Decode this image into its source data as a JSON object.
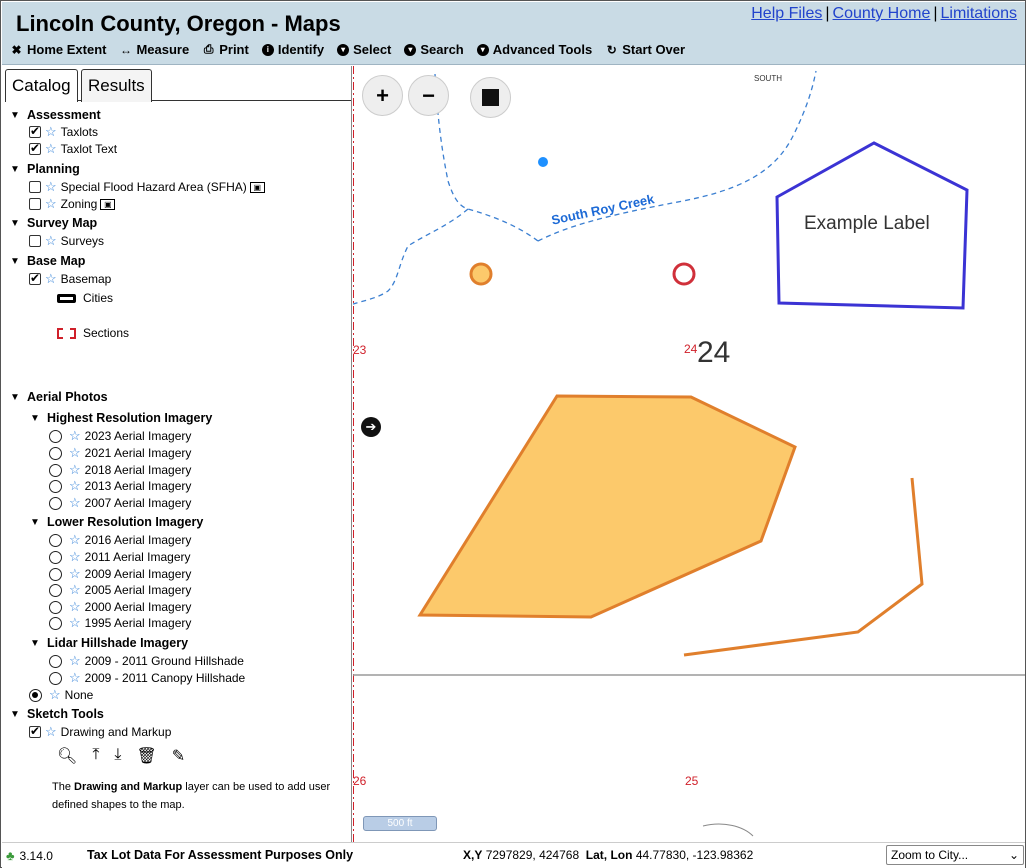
{
  "header": {
    "title": "Lincoln County, Oregon - Maps",
    "links": [
      "Help Files",
      "County Home",
      "Limitations"
    ],
    "link_separator": "|",
    "bg_color": "#c9dbe5"
  },
  "toolbar": [
    {
      "icon": "home-extent-icon",
      "label": "Home Extent"
    },
    {
      "icon": "measure-icon",
      "label": "Measure"
    },
    {
      "icon": "print-icon",
      "label": "Print"
    },
    {
      "icon": "info-icon",
      "label": "Identify"
    },
    {
      "icon": "chevron-circle-icon",
      "label": "Select"
    },
    {
      "icon": "chevron-circle-icon",
      "label": "Search"
    },
    {
      "icon": "chevron-circle-icon",
      "label": "Advanced Tools"
    },
    {
      "icon": "refresh-icon",
      "label": "Start Over"
    }
  ],
  "tabs": [
    "Catalog",
    "Results"
  ],
  "catalog": {
    "assessment": {
      "label": "Assessment",
      "items": [
        "Taxlots",
        "Taxlot Text"
      ]
    },
    "planning": {
      "label": "Planning",
      "items": [
        "Special Flood Hazard Area (SFHA)",
        "Zoning"
      ]
    },
    "survey_map": {
      "label": "Survey Map",
      "items": [
        "Surveys"
      ]
    },
    "base_map": {
      "label": "Base Map",
      "items": [
        "Basemap"
      ],
      "legend": [
        "Cities",
        "Sections"
      ]
    },
    "aerial_photos": {
      "label": "Aerial Photos",
      "highest": {
        "label": "Highest Resolution Imagery",
        "items": [
          "2023 Aerial Imagery",
          "2021 Aerial Imagery",
          "2018 Aerial Imagery",
          "2013 Aerial Imagery",
          "2007 Aerial Imagery"
        ]
      },
      "lower": {
        "label": "Lower Resolution Imagery",
        "items": [
          "2016 Aerial Imagery",
          "2011 Aerial Imagery",
          "2009 Aerial Imagery",
          "2005 Aerial Imagery",
          "2000 Aerial Imagery",
          "1995 Aerial Imagery"
        ]
      },
      "lidar": {
        "label": "Lidar Hillshade Imagery",
        "items": [
          "2009 - 2011 Ground Hillshade",
          "2009 - 2011 Canopy Hillshade"
        ]
      },
      "none": "None"
    },
    "sketch_tools": {
      "label": "Sketch Tools",
      "items": [
        "Drawing and Markup"
      ],
      "icons": [
        "zoom-icon",
        "upload-icon",
        "download-icon",
        "trash-icon",
        "pencil-icon"
      ],
      "desc_pre": "The ",
      "desc_bold": "Drawing and Markup",
      "desc_post": " layer can be used to add user defined shapes to the map."
    }
  },
  "map": {
    "creek_label": "South Roy Creek",
    "south_label": "SOUTH",
    "example_label": "Example Label",
    "section_labels": {
      "s23": "23",
      "s24": "24",
      "s24_big": "24",
      "s26": "26",
      "s25": "25"
    },
    "scale": "500 ft",
    "colors": {
      "polygon_fill": "#fcc96b",
      "polygon_stroke": "#e07f2c",
      "label_shape": "#3b33d4",
      "creek": "#3b7fd1",
      "section_line": "#d0202a"
    }
  },
  "footer": {
    "version": "3.14.0",
    "disclaimer": "Tax Lot Data For Assessment Purposes Only",
    "xy_label": "X,Y",
    "xy_value": "7297829, 424768",
    "latlon_label": "Lat, Lon",
    "latlon_value": "44.77830, -123.98362",
    "zoom_select": "Zoom to City..."
  }
}
